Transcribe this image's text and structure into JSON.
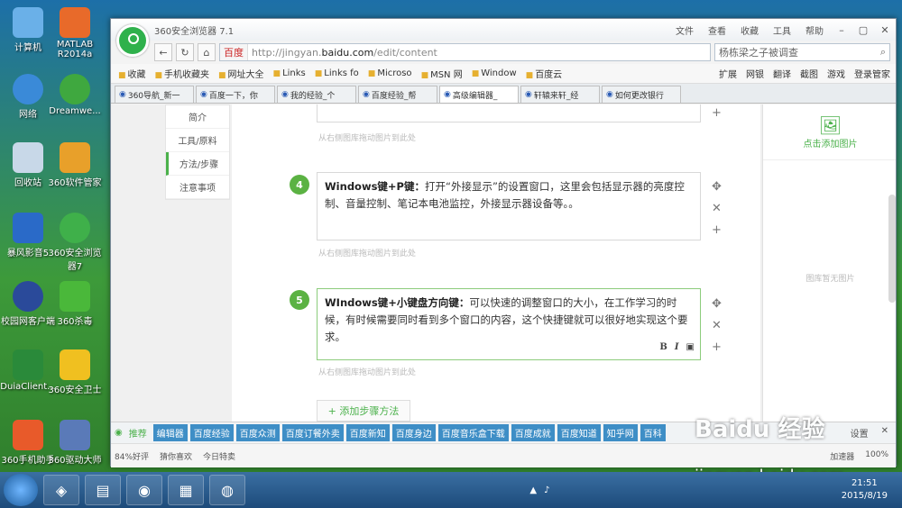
{
  "desktop": {
    "icons": [
      {
        "label": "计算机"
      },
      {
        "label": "MATLAB R2014a"
      },
      {
        "label": "网络"
      },
      {
        "label": "Dreamwe..."
      },
      {
        "label": "回收站"
      },
      {
        "label": "360软件管家"
      },
      {
        "label": "暴风影音5"
      },
      {
        "label": "360安全浏览器7"
      },
      {
        "label": "校园网客户端"
      },
      {
        "label": "360杀毒"
      },
      {
        "label": "DuiaClient..."
      },
      {
        "label": "360安全卫士"
      },
      {
        "label": "360手机助手"
      },
      {
        "label": "360驱动大师"
      }
    ]
  },
  "browser": {
    "title": "360安全浏览器 7.1",
    "menu": [
      "文件",
      "查看",
      "收藏",
      "工具",
      "帮助"
    ],
    "url_prefix": "http://jingyan.",
    "url_domain": "baidu.com",
    "url_path": "/edit/content",
    "url_badge": "百度",
    "search_placeholder": "杨栋梁之子被调查",
    "bookmarks": [
      "收藏",
      "手机收藏夹",
      "网址大全",
      "Links",
      "Links fo",
      "Microso",
      "MSN 网",
      "Window",
      "百度云"
    ],
    "toolbar_right": [
      "扩展",
      "网银",
      "翻译",
      "截图",
      "游戏",
      "登录管家"
    ],
    "tabs": [
      {
        "label": "360导航_新一"
      },
      {
        "label": "百度一下，你"
      },
      {
        "label": "我的经验_个"
      },
      {
        "label": "百度经验_帮"
      },
      {
        "label": "高级编辑器_"
      },
      {
        "label": "轩辕来轩_经"
      },
      {
        "label": "如何更改银行"
      }
    ]
  },
  "editor": {
    "leftnav": [
      "简介",
      "工具/原料",
      "方法/步骤",
      "注意事项"
    ],
    "img_hint": "从右侧图库拖动图片到此处",
    "steps": [
      {
        "num": "4",
        "title": "Windows键+P键：",
        "text": "打开“外接显示”的设置窗口，这里会包括显示器的亮度控制、音量控制、笔记本电池监控，外接显示器设备等。。"
      },
      {
        "num": "5",
        "title": "WIndows键+小键盘方向键：",
        "text": "可以快速的调整窗口的大小，在工作学习的时候，有时候需要同时看到多个窗口的内容，这个快捷键就可以很好地实现这个要求。"
      }
    ],
    "add_step": "+ 添加步骤方法",
    "rte": [
      "B",
      "I"
    ],
    "right_add": "点击添加图片",
    "right_empty": "图库暂无图片"
  },
  "recbar": {
    "label": "推荐",
    "chips": [
      "编辑器",
      "百度经验",
      "百度众测",
      "百度订餐外卖",
      "百度新知",
      "百度身边",
      "百度音乐盒下载",
      "百度成就",
      "百度知道",
      "知乎网",
      "百科"
    ],
    "settings": "设置"
  },
  "status": {
    "items": [
      "84%好评",
      "猜你喜欢",
      "今日特卖"
    ],
    "accelerator": "加速器",
    "zoom": "100%"
  },
  "taskbar": {
    "time": "21:51",
    "date": "2015/8/19"
  },
  "watermark": "Baidu 经验",
  "watermark_url": "jingyan.baidu.com"
}
